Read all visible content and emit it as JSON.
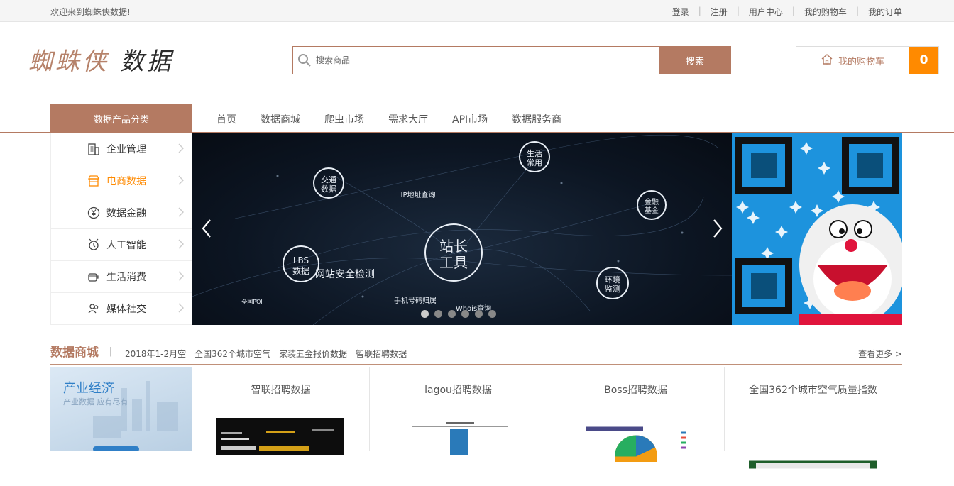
{
  "topbar": {
    "welcome": "欢迎来到蜘蛛侠数据!",
    "links": [
      "登录",
      "注册",
      "用户中心",
      "我的购物车",
      "我的订单"
    ],
    "separator": "|"
  },
  "logo": {
    "part1": "蜘蛛侠",
    "part2": "数据"
  },
  "search": {
    "placeholder": "搜索商品",
    "button": "搜索"
  },
  "cart": {
    "label": "我的购物车",
    "count": "0"
  },
  "nav": {
    "category_title": "数据产品分类",
    "links": [
      "首页",
      "数据商城",
      "爬虫市场",
      "需求大厅",
      "API市场",
      "数据服务商"
    ]
  },
  "sidebar": {
    "items": [
      {
        "label": "企业管理",
        "icon": "building-icon"
      },
      {
        "label": "电商数据",
        "icon": "store-icon",
        "active": true
      },
      {
        "label": "数据金融",
        "icon": "yen-icon"
      },
      {
        "label": "人工智能",
        "icon": "ai-icon"
      },
      {
        "label": "生活消费",
        "icon": "cup-icon"
      },
      {
        "label": "媒体社交",
        "icon": "people-icon"
      }
    ]
  },
  "banner": {
    "big": [
      "站长",
      "工具"
    ],
    "nodes": [
      {
        "lines": [
          "LBS",
          "数据"
        ]
      },
      {
        "lines": [
          "交通",
          "数据"
        ]
      },
      {
        "lines": [
          "生活",
          "常用"
        ]
      },
      {
        "lines": [
          "金融",
          "基金"
        ]
      },
      {
        "lines": [
          "环境",
          "监测"
        ]
      }
    ],
    "labels": [
      "IP地址查询",
      "网站安全检测",
      "手机号码归属",
      "Whois查询",
      "全国POI"
    ],
    "slide_count": 6,
    "active_slide": 1
  },
  "section": {
    "title": "数据商城",
    "bar": "|",
    "tags": [
      "2018年1-2月空",
      "全国362个城市空气",
      "家装五金报价数据",
      "智联招聘数据"
    ],
    "more": "查看更多 >"
  },
  "feature": {
    "title": "产业经济",
    "subtitle": "产业数据 应有尽有"
  },
  "cards": [
    {
      "title": "智联招聘数据"
    },
    {
      "title": "lagou招聘数据"
    },
    {
      "title": "Boss招聘数据"
    },
    {
      "title": "全国362个城市空气质量指数"
    }
  ],
  "colors": {
    "brand": "#b47a62",
    "accent": "#ff8a00"
  }
}
